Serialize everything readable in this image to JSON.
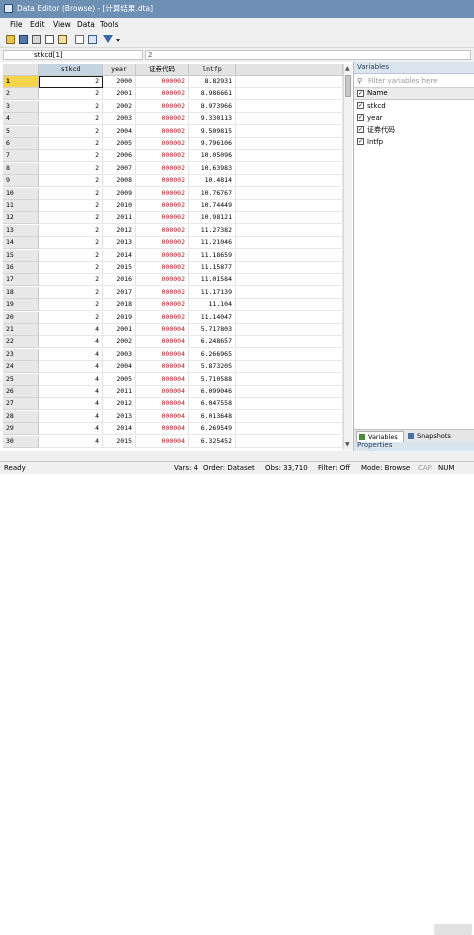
{
  "window": {
    "title": "Data Editor (Browse) - [计算结果.dta]"
  },
  "menu": [
    "File",
    "Edit",
    "View",
    "Data",
    "Tools"
  ],
  "toolbar": {
    "icons": [
      "open-icon",
      "save-icon",
      "print-icon",
      "copy-icon",
      "paste-icon",
      "edit-icon",
      "browse-icon",
      "filter-icon",
      "dropdown-icon"
    ]
  },
  "command": {
    "cell_ref": "stkcd[1]",
    "cell_value": "2"
  },
  "grid": {
    "columns": [
      "stkcd",
      "year",
      "证券代码",
      "lntfp"
    ],
    "rows": [
      [
        "1",
        "2",
        "2000",
        "000002",
        "8.82931"
      ],
      [
        "2",
        "2",
        "2001",
        "000002",
        "8.986661"
      ],
      [
        "3",
        "2",
        "2002",
        "000002",
        "8.973966"
      ],
      [
        "4",
        "2",
        "2003",
        "000002",
        "9.330113"
      ],
      [
        "5",
        "2",
        "2004",
        "000002",
        "9.509815"
      ],
      [
        "6",
        "2",
        "2005",
        "000002",
        "9.796106"
      ],
      [
        "7",
        "2",
        "2006",
        "000002",
        "10.05096"
      ],
      [
        "8",
        "2",
        "2007",
        "000002",
        "10.63983"
      ],
      [
        "9",
        "2",
        "2008",
        "000002",
        "10.4814"
      ],
      [
        "10",
        "2",
        "2009",
        "000002",
        "10.76767"
      ],
      [
        "11",
        "2",
        "2010",
        "000002",
        "10.74449"
      ],
      [
        "12",
        "2",
        "2011",
        "000002",
        "10.98121"
      ],
      [
        "13",
        "2",
        "2012",
        "000002",
        "11.27382"
      ],
      [
        "14",
        "2",
        "2013",
        "000002",
        "11.21046"
      ],
      [
        "15",
        "2",
        "2014",
        "000002",
        "11.18659"
      ],
      [
        "16",
        "2",
        "2015",
        "000002",
        "11.15877"
      ],
      [
        "17",
        "2",
        "2016",
        "000002",
        "11.01584"
      ],
      [
        "18",
        "2",
        "2017",
        "000002",
        "11.17139"
      ],
      [
        "19",
        "2",
        "2018",
        "000002",
        "11.104"
      ],
      [
        "20",
        "2",
        "2019",
        "000002",
        "11.14047"
      ],
      [
        "21",
        "4",
        "2001",
        "000004",
        "5.717803"
      ],
      [
        "22",
        "4",
        "2002",
        "000004",
        "6.248657"
      ],
      [
        "23",
        "4",
        "2003",
        "000004",
        "6.266965"
      ],
      [
        "24",
        "4",
        "2004",
        "000004",
        "5.873205"
      ],
      [
        "25",
        "4",
        "2005",
        "000004",
        "5.710588"
      ],
      [
        "26",
        "4",
        "2011",
        "000004",
        "6.099046"
      ],
      [
        "27",
        "4",
        "2012",
        "000004",
        "6.047558"
      ],
      [
        "28",
        "4",
        "2013",
        "000004",
        "6.013648"
      ],
      [
        "29",
        "4",
        "2014",
        "000004",
        "6.269549"
      ],
      [
        "30",
        "4",
        "2015",
        "000004",
        "6.325452"
      ]
    ]
  },
  "variables_panel": {
    "title": "Variables",
    "search_placeholder": "Filter variables here",
    "header": "Name",
    "items": [
      "stkcd",
      "year",
      "证券代码",
      "lntfp"
    ]
  },
  "tabs": [
    "Variables",
    "Snapshots"
  ],
  "properties_panel": {
    "title": "Properties"
  },
  "status": {
    "ready": "Ready",
    "vars": "Vars: 4",
    "order": "Order: Dataset",
    "obs": "Obs: 33,710",
    "filter": "Filter: Off",
    "mode": "Mode: Browse",
    "cap": "CAP",
    "num": "NUM"
  },
  "colors": {
    "title_bar": "#6d8fb3",
    "selected_row": "#f4d54c",
    "string_value": "#b01818"
  }
}
